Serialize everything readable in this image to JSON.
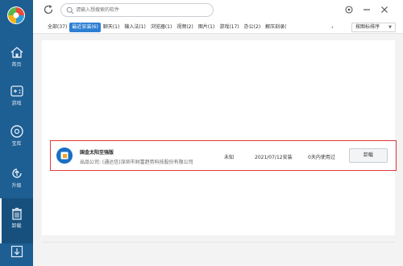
{
  "sidebar": {
    "items": [
      {
        "label": "首页",
        "icon": "home-icon"
      },
      {
        "label": "游戏",
        "icon": "gamepad-icon"
      },
      {
        "label": "宝库",
        "icon": "disc-icon"
      },
      {
        "label": "升级",
        "icon": "upgrade-icon"
      },
      {
        "label": "卸载",
        "icon": "trash-icon",
        "active": true
      }
    ],
    "bottom_icon": "download-icon"
  },
  "search": {
    "placeholder": "请输入想搜索的软件"
  },
  "tabs": [
    {
      "label": "全部(37)"
    },
    {
      "label": "最近安装(6)",
      "active": true
    },
    {
      "label": "聊天(1)"
    },
    {
      "label": "输入法(1)"
    },
    {
      "label": "浏览器(1)"
    },
    {
      "label": "视频(2)"
    },
    {
      "label": "图片(1)"
    },
    {
      "label": "游戏(17)"
    },
    {
      "label": "办公(2)"
    },
    {
      "label": "解压刻录("
    }
  ],
  "sort": {
    "label": "按图标排序"
  },
  "app": {
    "name": "国金太阳至强版",
    "publisher": "出品公司: (通达信)深圳市财富趋势科技股份有限公司",
    "size": "未知",
    "install_date": "2021/07/12安装",
    "usage": "0天内使用过",
    "uninstall_label": "卸载"
  },
  "colors": {
    "sidebar": "#1d5e93",
    "accent": "#2d7fd2",
    "highlight_border": "#e23a3a"
  }
}
